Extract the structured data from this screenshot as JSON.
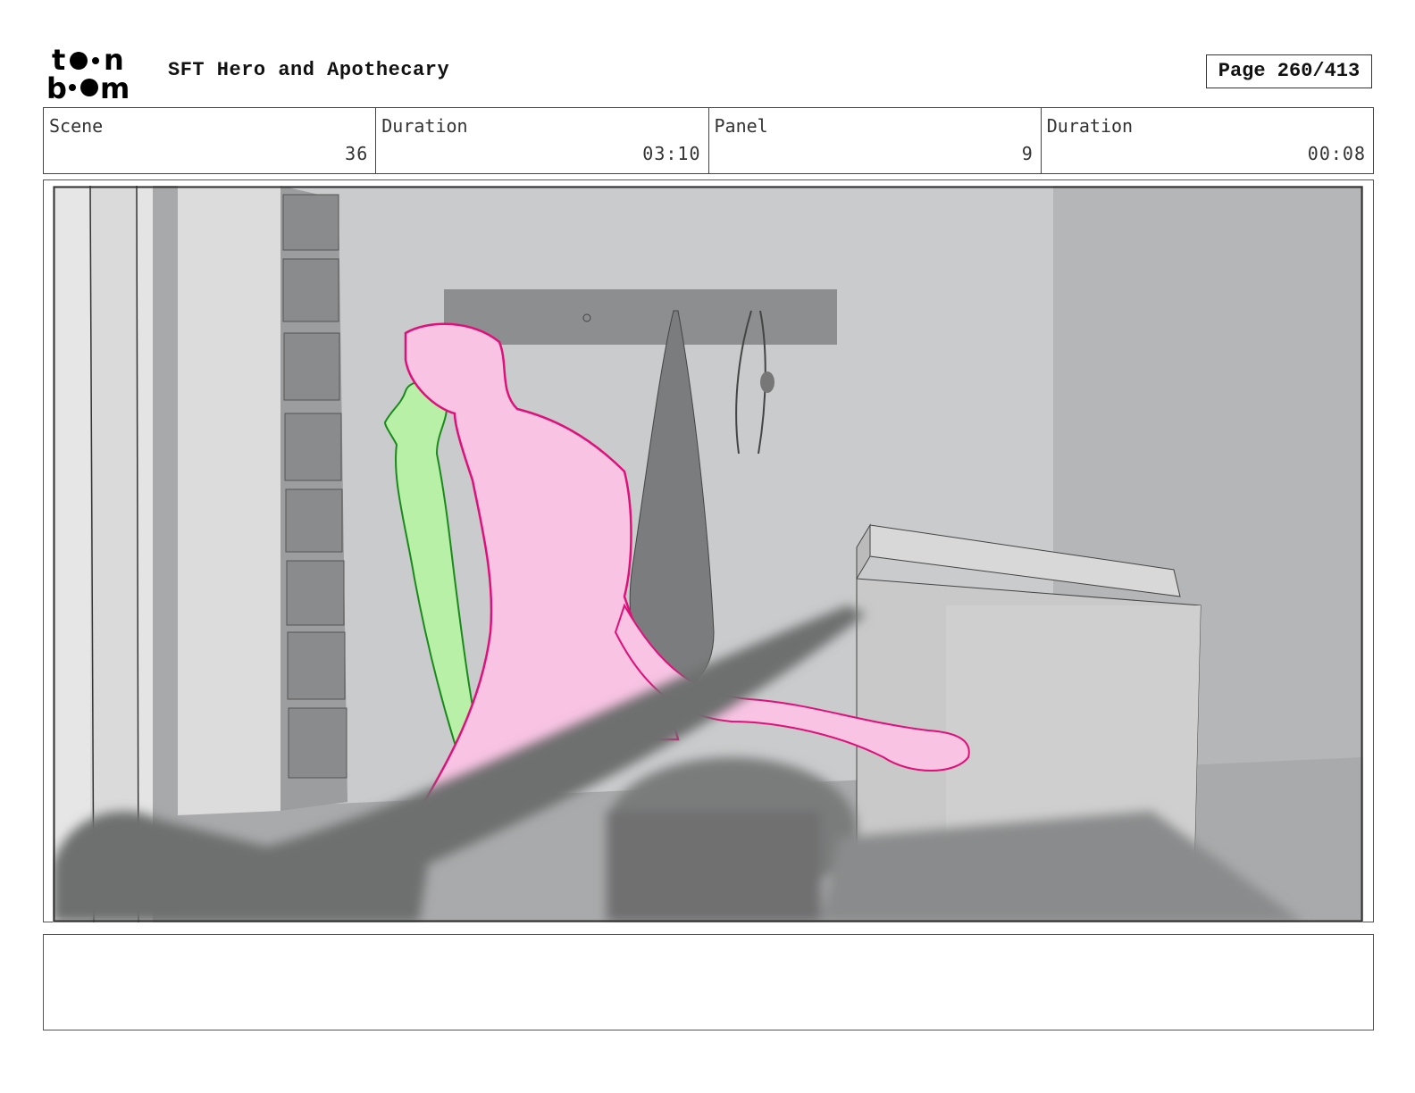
{
  "header": {
    "logo_name": "toon boom",
    "project_title": "SFT Hero and Apothecary",
    "page_label": "Page 260/413"
  },
  "info": {
    "scene_label": "Scene",
    "scene_value": "36",
    "scene_duration_label": "Duration",
    "scene_duration_value": "03:10",
    "panel_label": "Panel",
    "panel_value": "9",
    "panel_duration_label": "Duration",
    "panel_duration_value": "00:08"
  },
  "notes": {
    "text": ""
  },
  "colors": {
    "pink_character": "#f9c4e4",
    "pink_outline": "#e0107a",
    "green_character": "#b8f0a8",
    "green_outline": "#1a8a1a",
    "background_gray": "#c8cacb"
  }
}
